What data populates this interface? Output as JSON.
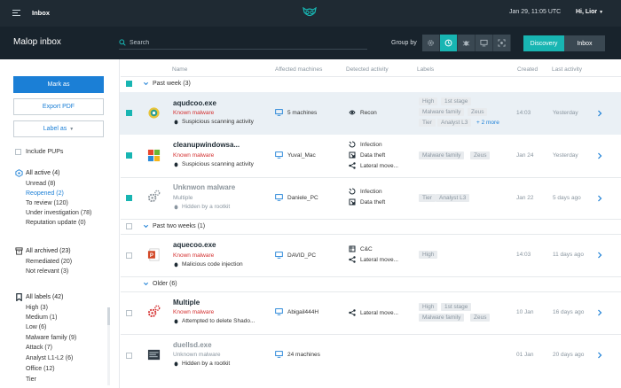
{
  "topbar": {
    "title": "Inbox",
    "datetime": "Jan 29, 11:05 UTC",
    "user": "Hi, Lior"
  },
  "header": {
    "title": "Malop inbox",
    "search_placeholder": "Search",
    "group_by_label": "Group by",
    "group_by_icons": [
      "gear-icon",
      "clock-icon",
      "bug-icon",
      "monitor-icon",
      "target-icon"
    ],
    "group_by_active": 1,
    "views": {
      "discovery": "Discovery",
      "inbox": "Inbox",
      "active": "Discovery"
    }
  },
  "sidebar": {
    "mark_as": "Mark as",
    "export_pdf": "Export PDF",
    "label_as": "Label as",
    "include_pups": "Include PUPs",
    "active": {
      "title": "All active (4)",
      "items": [
        "Unread (8)",
        "Reopened (2)",
        "To review (120)",
        "Under investigation (78)",
        "Reputation update (0)"
      ]
    },
    "archived": {
      "title": "All archived (23)",
      "items": [
        "Remediated (20)",
        "Not relevant (3)"
      ]
    },
    "labels": {
      "title": "All labels (42)",
      "items": [
        "High (3)",
        "Medium (1)",
        "Low (6)",
        "Malware family (9)",
        "Attack (7)",
        "Analyst L1-L2 (6)",
        "Office (12)",
        "Tier"
      ]
    }
  },
  "columns": {
    "name": "Name",
    "machines": "Affected machines",
    "activity": "Detected activity",
    "labels": "Labels",
    "created": "Created",
    "last": "Last activity"
  },
  "groups": {
    "past_week": "Past week (3)",
    "past_two_weeks": "Past two weeks (1)",
    "older": "Older (6)"
  },
  "rows": [
    {
      "name": "aqudcoo.exe",
      "classification": "Known malware",
      "detail": "Suspicious scanning activity",
      "machines": "5 machines",
      "activities": [
        "Recon"
      ],
      "labels": [
        "High",
        "1st stage",
        "Malware family",
        "Zeus",
        "Tier",
        "Analyst L3"
      ],
      "more": "+ 2 more",
      "created": "14:03",
      "last": "Yesterday"
    },
    {
      "name": "cleanupwindowsa...",
      "classification": "Known malware",
      "detail": "Suspicious scanning activity",
      "machines": "Yuval_Mac",
      "activities": [
        "Infection",
        "Data theft",
        "Lateral move..."
      ],
      "labels": [
        "Malware family",
        "Zeus"
      ],
      "created": "Jan 24",
      "last": "Yesterday"
    },
    {
      "name": "Unknwon malware",
      "classification": "Multiple",
      "detail": "Hidden by a rootkit",
      "machines": "Daniele_PC",
      "activities": [
        "Infection",
        "Data theft"
      ],
      "labels": [
        "Tier",
        "Analyst L3"
      ],
      "created": "Jan 22",
      "last": "5 days ago"
    },
    {
      "name": "aquecoo.exe",
      "classification": "Known malware",
      "detail": "Malicious code injection",
      "machines": "DAVID_PC",
      "activities": [
        "C&C",
        "Lateral move..."
      ],
      "labels": [
        "High"
      ],
      "created": "14:03",
      "last": "11 days ago"
    },
    {
      "name": "Multiple",
      "classification": "Known malware",
      "detail": "Attempted to delete Shado...",
      "machines": "Abigail444H",
      "activities": [
        "Lateral move..."
      ],
      "labels": [
        "High",
        "1st stage",
        "Malware family",
        "Zeus"
      ],
      "created": "10 Jan",
      "last": "16 days ago"
    },
    {
      "name": "duellsd.exe",
      "classification": "Unknown malware",
      "detail": "Hidden by a rootkit",
      "machines": "24 machines",
      "activities": [],
      "labels": [],
      "created": "01 Jan",
      "last": "20 days ago"
    }
  ],
  "colors": {
    "teal": "#18b5b2",
    "blue": "#1b7fd6",
    "red": "#d42f2f",
    "topbar": "#1f2a33",
    "header": "#18232c"
  }
}
